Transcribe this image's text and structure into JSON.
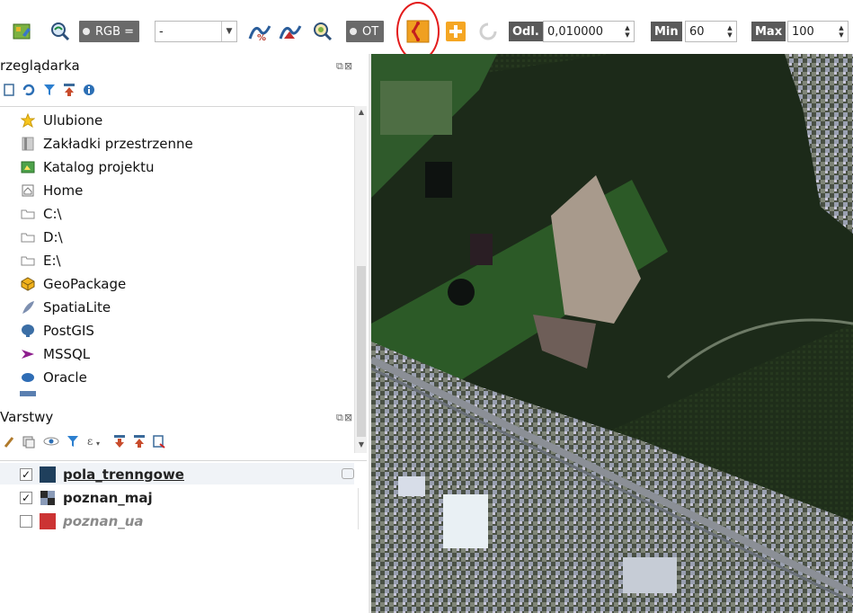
{
  "toolbar": {
    "band_label": "RGB =",
    "band_combo_value": "-",
    "ot_label": "OT",
    "dist_label": "Odl.",
    "dist_value": "0,010000",
    "min_label": "Min",
    "min_value": "60",
    "max_label": "Max",
    "max_value": "100"
  },
  "browser": {
    "title": "rzeglądarka",
    "items": [
      {
        "label": "Ulubione",
        "icon": "star-icon"
      },
      {
        "label": "Zakładki przestrzenne",
        "icon": "bookmark-icon"
      },
      {
        "label": "Katalog projektu",
        "icon": "project-folder-icon"
      },
      {
        "label": "Home",
        "icon": "home-icon"
      },
      {
        "label": "C:\\",
        "icon": "folder-icon"
      },
      {
        "label": "D:\\",
        "icon": "folder-icon"
      },
      {
        "label": "E:\\",
        "icon": "folder-icon"
      },
      {
        "label": "GeoPackage",
        "icon": "geopackage-icon"
      },
      {
        "label": "SpatiaLite",
        "icon": "spatialite-icon"
      },
      {
        "label": "PostGIS",
        "icon": "postgis-icon"
      },
      {
        "label": "MSSQL",
        "icon": "mssql-icon"
      },
      {
        "label": "Oracle",
        "icon": "oracle-icon"
      }
    ]
  },
  "layers": {
    "title": "Varstwy",
    "items": [
      {
        "label": "pola_trenngowe",
        "checked": true,
        "color": "#1f3f5c"
      },
      {
        "label": "poznan_maj",
        "checked": true,
        "color": "#444444"
      },
      {
        "label": "poznan_ua",
        "checked": false,
        "color": "#cc3333"
      }
    ]
  },
  "colors": {
    "highlight_circle": "#e31b1b",
    "toolbar_label_bg": "#5a5a5a"
  }
}
